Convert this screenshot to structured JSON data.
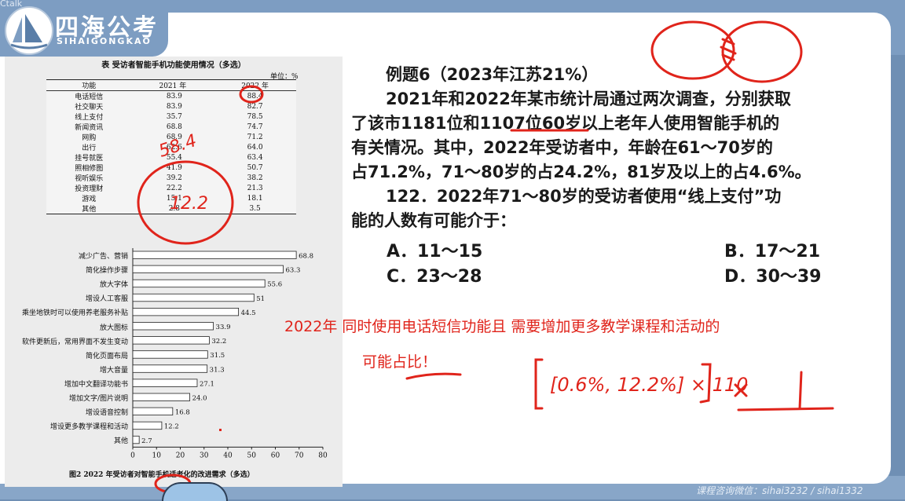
{
  "top_tag": "Ctalk",
  "logo": {
    "title": "四海公考",
    "subtitle": "SIHAIGONGKAO"
  },
  "table": {
    "title": "表   受访者智能手机功能使用情况（多选）",
    "unit": "单位：%",
    "headers": [
      "功能",
      "2021 年",
      "2022 年"
    ],
    "rows": [
      [
        "电话短信",
        "83.9",
        "88.4"
      ],
      [
        "社交聊天",
        "83.9",
        "82.7"
      ],
      [
        "线上支付",
        "35.7",
        "78.5"
      ],
      [
        "新闻资讯",
        "68.8",
        "74.7"
      ],
      [
        "网购",
        "68.9",
        "71.2"
      ],
      [
        "出行",
        "62.6",
        "64.0"
      ],
      [
        "挂号就医",
        "55.4",
        "63.4"
      ],
      [
        "照相修图",
        "41.9",
        "50.7"
      ],
      [
        "视听娱乐",
        "39.2",
        "38.2"
      ],
      [
        "投资理财",
        "22.2",
        "21.3"
      ],
      [
        "游戏",
        "15.1",
        "18.1"
      ],
      [
        "其他",
        "2.8",
        "3.5"
      ]
    ]
  },
  "chart_data": {
    "type": "bar",
    "title": "图2   2022 年受访者对智能手机适老化的改进需求（多选）",
    "categories": [
      "减少广告、营销",
      "简化操作步骤",
      "放大字体",
      "增设人工客服",
      "乘坐地铁时可以使用养老服务补贴",
      "放大图标",
      "软件更新后，常用界面不发生变动",
      "简化页面布局",
      "增大音量",
      "增加中文翻译功能书",
      "增加文字/图片说明",
      "增设语音控制",
      "增设更多教学课程和活动",
      "其他"
    ],
    "values": [
      68.8,
      63.3,
      55.6,
      51,
      44.5,
      33.9,
      32.2,
      31.5,
      31.3,
      27.1,
      24.0,
      16.8,
      12.2,
      2.7
    ],
    "value_labels": [
      "68.8",
      "63.3",
      "55.6",
      "51",
      "44.5",
      "33.9",
      "32.2",
      "31.5",
      "31.3",
      "27.1",
      "24.0",
      "16.8",
      "12.2",
      "2.7"
    ],
    "xlim": [
      0,
      80
    ],
    "xticks": [
      "0",
      "10",
      "20",
      "30",
      "40",
      "50",
      "60",
      "70",
      "80"
    ]
  },
  "question": {
    "lines": [
      "例题6（2023年江苏21%）",
      "2021年和2022年某市统计局通过两次调查，分别获取",
      "了该市1181位和1107位60岁以上老年人使用智能手机的",
      "有关情况。其中，2022年受访者中，年龄在61～70岁的",
      "占71.2%，71～80岁的占24.2%，81岁及以上的占4.6%。",
      "122．2022年71～80岁的受访者使用“线上支付”功",
      "能的人数有可能介于："
    ],
    "options": {
      "a": "A．11～15",
      "b": "B．17～21",
      "c": "C．23～28",
      "d": "D．30～39"
    }
  },
  "annotations": {
    "red_line1": "2022年 同时使用电话短信功能且  需要增加更多教学课程和活动的",
    "red_line2": "可能占比！",
    "hand_formula": "[0.6%, 12.2%] × 110",
    "hand_58": "58.4",
    "hand_122": "12.2"
  },
  "footer_watermark": "课程咨询微信：sihai3232 / sihai1332",
  "colors": {
    "annotation_red": "#e0241b",
    "background_blue": "#6f8fb4"
  }
}
